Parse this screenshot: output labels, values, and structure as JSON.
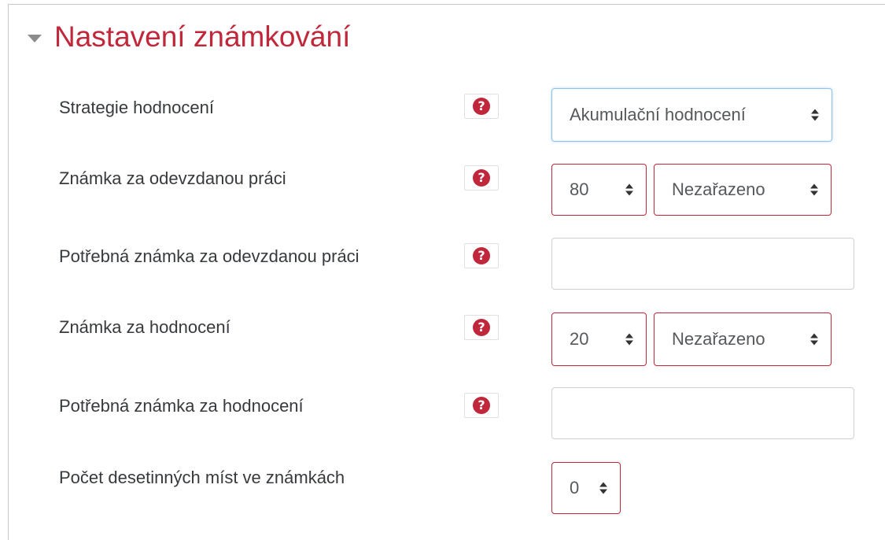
{
  "section": {
    "title": "Nastavení známkování",
    "icon": "chevron-down-icon"
  },
  "fields": {
    "grading_strategy": {
      "label": "Strategie hodnocení",
      "help_icon": "question-circle-icon",
      "help_glyph": "?",
      "value": "Akumulační hodnocení"
    },
    "submission_grade": {
      "label": "Známka za odevzdanou práci",
      "help_icon": "question-circle-icon",
      "help_glyph": "?",
      "grade_value": "80",
      "category_value": "Nezařazeno"
    },
    "submission_pass_grade": {
      "label": "Potřebná známka za odevzdanou práci",
      "help_icon": "question-circle-icon",
      "help_glyph": "?",
      "value": ""
    },
    "assessment_grade": {
      "label": "Známka za hodnocení",
      "help_icon": "question-circle-icon",
      "help_glyph": "?",
      "grade_value": "20",
      "category_value": "Nezařazeno"
    },
    "assessment_pass_grade": {
      "label": "Potřebná známka za hodnocení",
      "help_icon": "question-circle-icon",
      "help_glyph": "?",
      "value": ""
    },
    "decimal_places": {
      "label": "Počet desetinných míst ve známkách",
      "value": "0"
    }
  },
  "colors": {
    "accent": "#c1273a",
    "focus_border": "#8cc3ee",
    "text": "#373a3c"
  }
}
